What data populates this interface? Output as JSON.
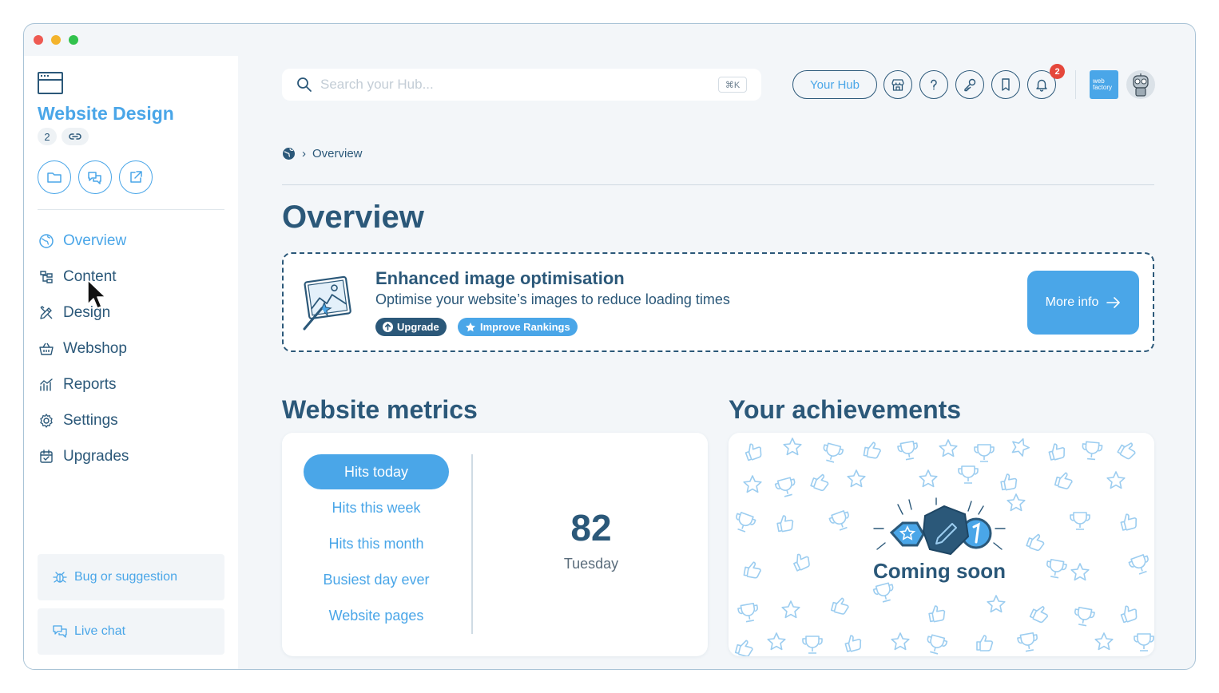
{
  "sidebar": {
    "title": "Website Design",
    "count": "2",
    "nav": [
      {
        "label": "Overview",
        "icon": "globe-icon"
      },
      {
        "label": "Content",
        "icon": "sitemap-icon"
      },
      {
        "label": "Design",
        "icon": "pencil-ruler-icon"
      },
      {
        "label": "Webshop",
        "icon": "basket-icon"
      },
      {
        "label": "Reports",
        "icon": "chart-icon"
      },
      {
        "label": "Settings",
        "icon": "gear-icon"
      },
      {
        "label": "Upgrades",
        "icon": "calendar-check-icon"
      }
    ],
    "bug_label": "Bug or suggestion",
    "chat_label": "Live chat"
  },
  "topbar": {
    "search_placeholder": "Search your Hub...",
    "shortcut": "⌘K",
    "hub_label": "Your Hub",
    "notification_count": "2",
    "brand_line1": "web",
    "brand_line2": "factory"
  },
  "breadcrumb": {
    "current": "Overview"
  },
  "page": {
    "title": "Overview"
  },
  "promo": {
    "title": "Enhanced image optimisation",
    "description": "Optimise your website’s images to reduce loading times",
    "tag_upgrade": "Upgrade",
    "tag_rankings": "Improve Rankings",
    "button_label": "More info"
  },
  "metrics": {
    "title": "Website metrics",
    "tabs": [
      "Hits today",
      "Hits this week",
      "Hits this month",
      "Busiest day ever",
      "Website pages"
    ],
    "value": "82",
    "day": "Tuesday"
  },
  "achievements": {
    "title": "Your achievements",
    "status": "Coming soon"
  },
  "colors": {
    "accent": "#4aa6e8",
    "dark": "#2b5879",
    "badge": "#e5473b"
  }
}
